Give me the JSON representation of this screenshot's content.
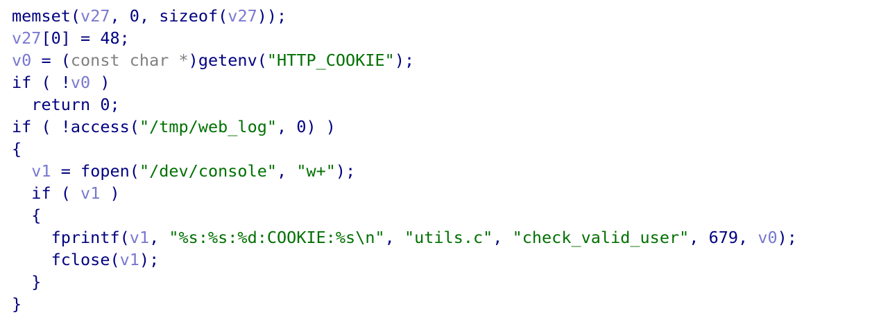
{
  "colors": {
    "background": "#ffffff",
    "keyword": "#000080",
    "function": "#000080",
    "variable": "#7878d0",
    "number": "#000080",
    "string": "#007000",
    "punctuation": "#000080",
    "type": "#808080"
  },
  "code_lines": [
    {
      "tokens": [
        {
          "t": "fn",
          "v": "memset"
        },
        {
          "t": "punct",
          "v": "("
        },
        {
          "t": "var",
          "v": "v27"
        },
        {
          "t": "punct",
          "v": ", "
        },
        {
          "t": "num",
          "v": "0"
        },
        {
          "t": "punct",
          "v": ", "
        },
        {
          "t": "kw",
          "v": "sizeof"
        },
        {
          "t": "punct",
          "v": "("
        },
        {
          "t": "var",
          "v": "v27"
        },
        {
          "t": "punct",
          "v": "));"
        }
      ]
    },
    {
      "tokens": [
        {
          "t": "var",
          "v": "v27"
        },
        {
          "t": "punct",
          "v": "["
        },
        {
          "t": "num",
          "v": "0"
        },
        {
          "t": "punct",
          "v": "] = "
        },
        {
          "t": "num",
          "v": "48"
        },
        {
          "t": "punct",
          "v": ";"
        }
      ]
    },
    {
      "tokens": [
        {
          "t": "var",
          "v": "v0"
        },
        {
          "t": "punct",
          "v": " = ("
        },
        {
          "t": "type",
          "v": "const char *"
        },
        {
          "t": "punct",
          "v": ")"
        },
        {
          "t": "fn",
          "v": "getenv"
        },
        {
          "t": "punct",
          "v": "("
        },
        {
          "t": "str",
          "v": "\"HTTP_COOKIE\""
        },
        {
          "t": "punct",
          "v": ");"
        }
      ]
    },
    {
      "tokens": [
        {
          "t": "kw",
          "v": "if"
        },
        {
          "t": "punct",
          "v": " ( !"
        },
        {
          "t": "var",
          "v": "v0"
        },
        {
          "t": "punct",
          "v": " )"
        }
      ]
    },
    {
      "tokens": [
        {
          "t": "ws",
          "v": "  "
        },
        {
          "t": "kw",
          "v": "return"
        },
        {
          "t": "punct",
          "v": " "
        },
        {
          "t": "num",
          "v": "0"
        },
        {
          "t": "punct",
          "v": ";"
        }
      ]
    },
    {
      "tokens": [
        {
          "t": "kw",
          "v": "if"
        },
        {
          "t": "punct",
          "v": " ( !"
        },
        {
          "t": "fn",
          "v": "access"
        },
        {
          "t": "punct",
          "v": "("
        },
        {
          "t": "str",
          "v": "\"/tmp/web_log\""
        },
        {
          "t": "punct",
          "v": ", "
        },
        {
          "t": "num",
          "v": "0"
        },
        {
          "t": "punct",
          "v": ") )"
        }
      ]
    },
    {
      "tokens": [
        {
          "t": "punct",
          "v": "{"
        }
      ]
    },
    {
      "tokens": [
        {
          "t": "ws",
          "v": "  "
        },
        {
          "t": "var",
          "v": "v1"
        },
        {
          "t": "punct",
          "v": " = "
        },
        {
          "t": "fn",
          "v": "fopen"
        },
        {
          "t": "punct",
          "v": "("
        },
        {
          "t": "str",
          "v": "\"/dev/console\""
        },
        {
          "t": "punct",
          "v": ", "
        },
        {
          "t": "str",
          "v": "\"w+\""
        },
        {
          "t": "punct",
          "v": ");"
        }
      ]
    },
    {
      "tokens": [
        {
          "t": "ws",
          "v": "  "
        },
        {
          "t": "kw",
          "v": "if"
        },
        {
          "t": "punct",
          "v": " ( "
        },
        {
          "t": "var",
          "v": "v1"
        },
        {
          "t": "punct",
          "v": " )"
        }
      ]
    },
    {
      "tokens": [
        {
          "t": "ws",
          "v": "  "
        },
        {
          "t": "punct",
          "v": "{"
        }
      ]
    },
    {
      "tokens": [
        {
          "t": "ws",
          "v": "    "
        },
        {
          "t": "fn",
          "v": "fprintf"
        },
        {
          "t": "punct",
          "v": "("
        },
        {
          "t": "var",
          "v": "v1"
        },
        {
          "t": "punct",
          "v": ", "
        },
        {
          "t": "str",
          "v": "\"%s:%s:%d:COOKIE:%s\\n\""
        },
        {
          "t": "punct",
          "v": ", "
        },
        {
          "t": "str",
          "v": "\"utils.c\""
        },
        {
          "t": "punct",
          "v": ", "
        },
        {
          "t": "str",
          "v": "\"check_valid_user\""
        },
        {
          "t": "punct",
          "v": ", "
        },
        {
          "t": "num",
          "v": "679"
        },
        {
          "t": "punct",
          "v": ", "
        },
        {
          "t": "var",
          "v": "v0"
        },
        {
          "t": "punct",
          "v": ");"
        }
      ]
    },
    {
      "tokens": [
        {
          "t": "ws",
          "v": "    "
        },
        {
          "t": "fn",
          "v": "fclose"
        },
        {
          "t": "punct",
          "v": "("
        },
        {
          "t": "var",
          "v": "v1"
        },
        {
          "t": "punct",
          "v": ");"
        }
      ]
    },
    {
      "tokens": [
        {
          "t": "ws",
          "v": "  "
        },
        {
          "t": "punct",
          "v": "}"
        }
      ]
    },
    {
      "tokens": [
        {
          "t": "punct",
          "v": "}"
        }
      ]
    }
  ]
}
